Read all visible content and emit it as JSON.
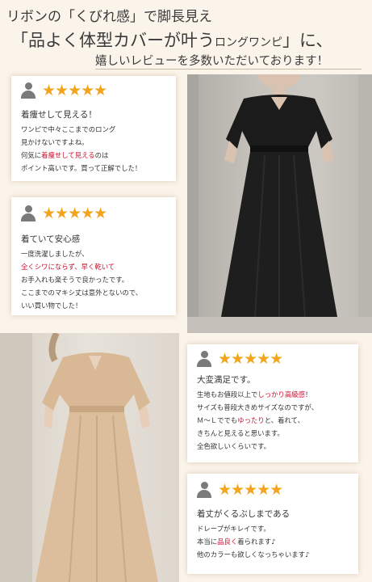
{
  "header": {
    "line1": "リボンの「くびれ感」で脚長見え",
    "line2_main": "「品よく体型カバーが叶う",
    "line2_small": "ロングワンピ",
    "line2_end": "」に、",
    "line3": "嬉しいレビューを多数いただいております！"
  },
  "colors": {
    "accent_star": "#f3a51c",
    "highlight": "#c8102e",
    "background": "#fbf4ea"
  },
  "reviews": [
    {
      "stars": "★★★★★",
      "title": "着痩せして見える！",
      "lines": [
        "ワンピで中々ここまでのロング",
        "見かけないですよね。",
        {
          "pre": "何気に",
          "hl": "着痩せして見える",
          "post": "のは"
        },
        "ポイント高いです。買って正解でした！"
      ]
    },
    {
      "stars": "★★★★★",
      "title": "着ていて安心感",
      "lines": [
        "一度洗濯しましたが、",
        {
          "pre": "",
          "hl": "全くシワにならず、早く乾いて",
          "post": ""
        },
        "お手入れも楽そうで良かったです。",
        "ここまでのマキシ丈は意外とないので、",
        "いい買い物でした！"
      ]
    },
    {
      "stars": "★★★★★",
      "title": "大変満足です。",
      "lines": [
        {
          "pre": "生地もお値段以上で",
          "hl": "しっかり高級感",
          "post": "！"
        },
        "サイズも普段大きめサイズなのですが、",
        {
          "pre": "Ｍ～Ｌででも",
          "hl": "ゆったり",
          "post": "と、着れて、"
        },
        "きちんと見えると思います。",
        "全色欲しいくらいです。"
      ]
    },
    {
      "stars": "★★★★★",
      "title": "着丈がくるぶしまである",
      "lines": [
        "ドレープがキレイです。",
        {
          "pre": "本当に",
          "hl": "品良く",
          "post": "着られます♪"
        },
        "他のカラーも欲しくなっちゃいます♪"
      ]
    }
  ]
}
